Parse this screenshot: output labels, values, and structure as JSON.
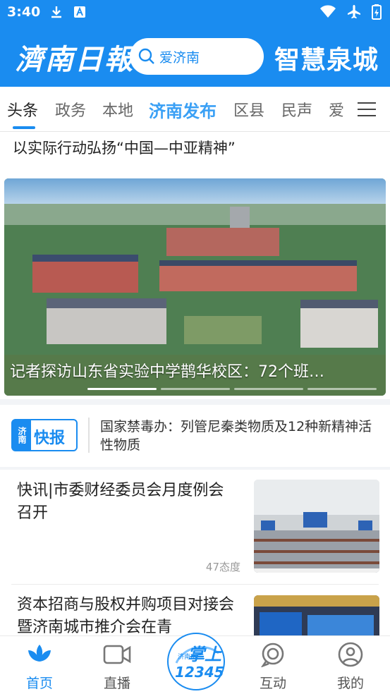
{
  "status_bar": {
    "time": "3:40"
  },
  "header": {
    "logo_text": "濟南日報",
    "search_placeholder": "爱济南",
    "brand_text": "智慧泉城"
  },
  "tabs": [
    "头条",
    "政务",
    "本地",
    "济南发布",
    "区县",
    "民声",
    "爱"
  ],
  "headline": "以实际行动弘扬“中国—中亚精神”",
  "banner": {
    "caption": "记者探访山东省实验中学鹊华校区：72个班…",
    "active_index": 0
  },
  "flash": {
    "logo_left": "济南",
    "logo_right": "快报",
    "text": "国家禁毒办：列管尼秦类物质及12种新精神活性物质"
  },
  "news": [
    {
      "title": "快讯|市委财经委员会月度例会召开",
      "meta": "47态度"
    },
    {
      "title": "资本招商与股权并购项目对接会暨济南城市推介会在青",
      "meta": ""
    }
  ],
  "bottom_nav": [
    {
      "label": "首页",
      "icon": "lotus-icon"
    },
    {
      "label": "直播",
      "icon": "video-icon"
    },
    {
      "label": "",
      "icon": "zhangshang-12345-logo"
    },
    {
      "label": "互动",
      "icon": "chat-icon"
    },
    {
      "label": "我的",
      "icon": "user-icon"
    }
  ],
  "center_logo": {
    "top": "掌上",
    "side": "济南市",
    "bottom": "12345"
  },
  "colors": {
    "accent": "#1a8cf0",
    "tab_highlight": "#3aa0f5"
  }
}
